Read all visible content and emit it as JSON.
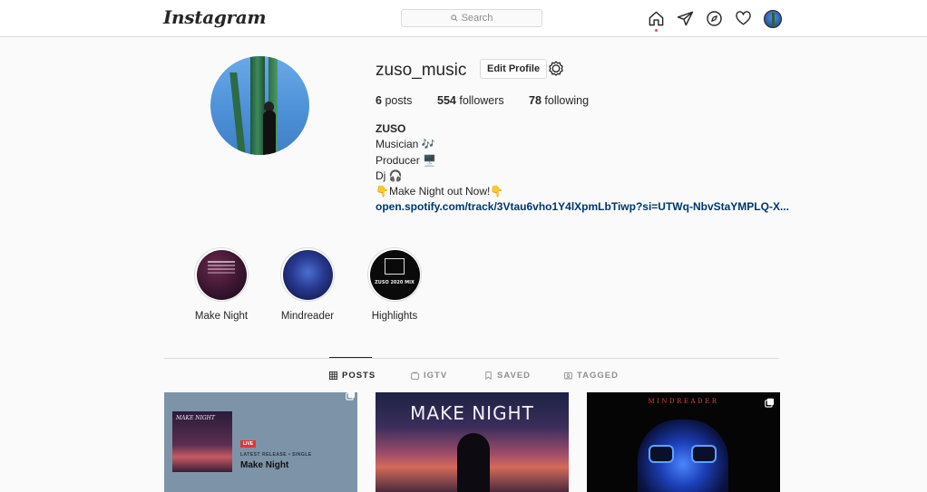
{
  "nav": {
    "logo": "Instagram",
    "search_placeholder": "Search"
  },
  "profile": {
    "username": "zuso_music",
    "edit_label": "Edit Profile",
    "posts_count": "6",
    "posts_label": "posts",
    "followers_count": "554",
    "followers_label": "followers",
    "following_count": "78",
    "following_label": "following",
    "bio": {
      "name": "ZUSO",
      "lines": [
        "Musician 🎶",
        "Producer 🖥️",
        "Dj 🎧",
        "👇Make Night out Now!👇"
      ],
      "link": "open.spotify.com/track/3Vtau6vho1Y4lXpmLbTiwp?si=UTWq-NbvStaYMPLQ-X..."
    }
  },
  "highlights": [
    {
      "label": "Make Night"
    },
    {
      "label": "Mindreader"
    },
    {
      "label": "Highlights",
      "cover_text": "ZUSO 2020 MIX"
    }
  ],
  "tabs": [
    {
      "label": "POSTS",
      "icon": "grid-icon",
      "active": true
    },
    {
      "label": "IGTV",
      "icon": "igtv-icon",
      "active": false
    },
    {
      "label": "SAVED",
      "icon": "bookmark-icon",
      "active": false
    },
    {
      "label": "TAGGED",
      "icon": "tag-icon",
      "active": false
    }
  ],
  "posts": [
    {
      "cover_title": "MAKE NIGHT",
      "badge": "LIVE",
      "subtitle": "LATEST RELEASE • SINGLE",
      "title": "Make Night"
    },
    {
      "headline": "MAKE NIGHT"
    },
    {
      "headline": "MINDREADER"
    }
  ],
  "colors": {
    "link": "#00376b",
    "notification_dot": "#ed4956",
    "border": "#dbdbdb",
    "muted": "#8e8e8e"
  }
}
